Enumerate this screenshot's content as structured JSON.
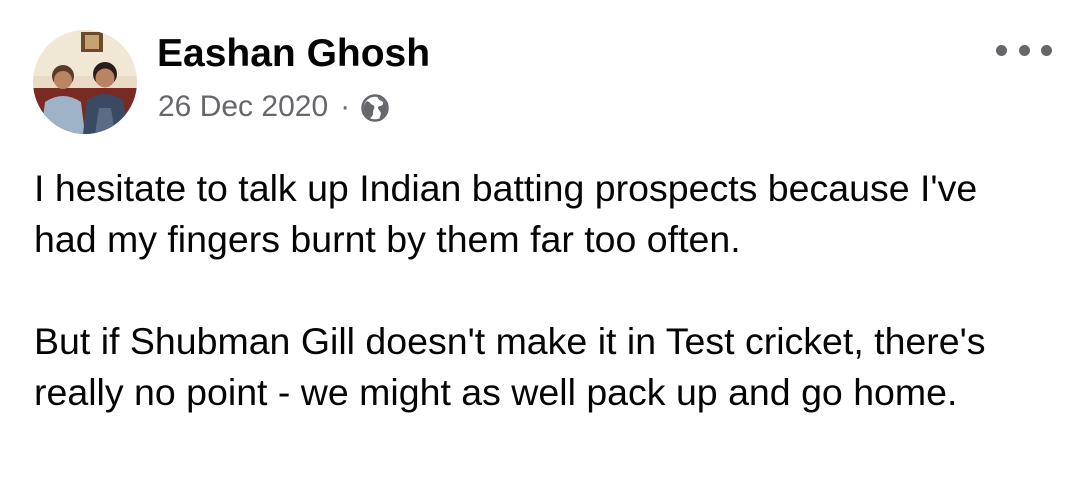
{
  "post": {
    "author": "Eashan Ghosh",
    "date": "26 Dec 2020",
    "separator": "·",
    "audience_icon": "globe-icon",
    "more_icon": "more-options-icon",
    "paragraphs": [
      "I hesitate to talk up Indian batting prospects because I've had my fingers burnt by them far too often.",
      "But if Shubman Gill doesn't make it in Test cricket, there's really no point - we might as well pack up and go home."
    ]
  },
  "colors": {
    "text": "#050505",
    "secondary_text": "#65676b",
    "background": "#ffffff"
  }
}
